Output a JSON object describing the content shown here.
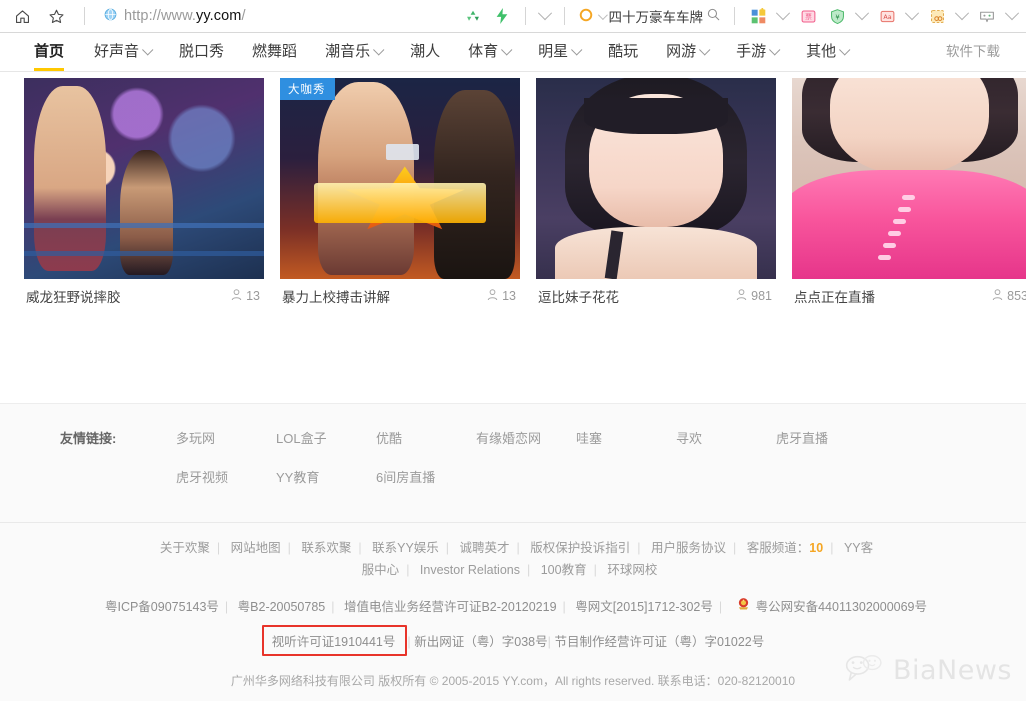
{
  "browser": {
    "home_icon": "home-icon",
    "favorite_icon": "star-icon",
    "site_icon": "globe-icon",
    "url_prefix": "http://www.",
    "url_domain": "yy.com",
    "url_suffix": "/",
    "search_keyword": "四十万豪车车牌",
    "toolbar_icons": [
      {
        "name": "recycle-icon",
        "glyph": "♻"
      },
      {
        "name": "lightning-icon",
        "glyph": "⚡"
      },
      {
        "name": "apps-grid-icon",
        "glyph": "grid"
      },
      {
        "name": "coupon-icon",
        "glyph": "票"
      },
      {
        "name": "shield-money-icon",
        "glyph": "¥"
      },
      {
        "name": "translate-icon",
        "glyph": "Aa"
      },
      {
        "name": "screenshot-icon",
        "glyph": "✂"
      },
      {
        "name": "game-icon",
        "glyph": "🎮"
      }
    ]
  },
  "nav": {
    "items": [
      {
        "label": "首页",
        "has_caret": false,
        "active": true
      },
      {
        "label": "好声音",
        "has_caret": true,
        "active": false
      },
      {
        "label": "脱口秀",
        "has_caret": false,
        "active": false
      },
      {
        "label": "燃舞蹈",
        "has_caret": false,
        "active": false
      },
      {
        "label": "潮音乐",
        "has_caret": true,
        "active": false
      },
      {
        "label": "潮人",
        "has_caret": false,
        "active": false
      },
      {
        "label": "体育",
        "has_caret": true,
        "active": false
      },
      {
        "label": "明星",
        "has_caret": true,
        "active": false
      },
      {
        "label": "酷玩",
        "has_caret": false,
        "active": false
      },
      {
        "label": "网游",
        "has_caret": true,
        "active": false
      },
      {
        "label": "手游",
        "has_caret": true,
        "active": false
      },
      {
        "label": "其他",
        "has_caret": true,
        "active": false
      }
    ],
    "download_label": "软件下载",
    "active_underline_color": "#ffc800"
  },
  "cards": [
    {
      "title": "威龙狂野说摔胶",
      "views": "13",
      "badge": "",
      "art": "t1"
    },
    {
      "title": "暴力上校搏击讲解",
      "views": "13",
      "badge": "大咖秀",
      "art": "t2"
    },
    {
      "title": "逗比妹子花花",
      "views": "981",
      "badge": "",
      "art": "t3"
    },
    {
      "title": "点点正在直播",
      "views": "853",
      "badge": "",
      "art": "t4"
    }
  ],
  "friend_links": {
    "label": "友情链接:",
    "items": [
      "多玩网",
      "LOL盒子",
      "优酷",
      "有缘婚恋网",
      "哇塞",
      "寻欢",
      "虎牙直播",
      "虎牙视频",
      "YY教育",
      "6间房直播"
    ]
  },
  "footer_links": [
    "关于欢聚",
    "网站地图",
    "联系欢聚",
    "联系YY娱乐",
    "诚聘英才",
    "版权保护投诉指引",
    "用户服务协议"
  ],
  "service_channel": {
    "label": "客服频道：",
    "value": "10"
  },
  "footer_links_tail": [
    "YY客服中心",
    "Investor Relations",
    "100教育",
    "环球网校"
  ],
  "licenses_row1": [
    "粤ICP备09075143号",
    "粤B2-20050785",
    "增值电信业务经营许可证B2-20120219",
    "粤网文[2015]1712-302号"
  ],
  "police_record": {
    "icon": "police-badge-icon",
    "label": "粤公网安备44011302000069号"
  },
  "licenses_row2": {
    "highlighted": "视听许可证1910441号",
    "others": [
      "新出网证（粤）字038号",
      "节目制作经营许可证（粤）字01022号"
    ],
    "highlight_color": "#e8342a"
  },
  "copyright": "广州华多网络科技有限公司 版权所有 © 2005-2015 YY.com，All rights reserved. 联系电话：020-82120010",
  "watermark": {
    "text": "BiaNews",
    "icon": "chat-faces-icon"
  }
}
